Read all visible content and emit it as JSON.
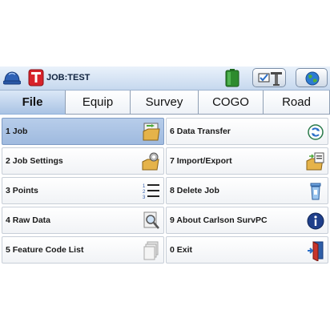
{
  "titlebar": {
    "job_title": "JOB:TEST",
    "icons": [
      "hard-hat-icon",
      "job-file-icon",
      "battery-icon",
      "equipment-icon",
      "globe-icon"
    ]
  },
  "tabs": [
    {
      "label": "File",
      "active": true
    },
    {
      "label": "Equip",
      "active": false
    },
    {
      "label": "Survey",
      "active": false
    },
    {
      "label": "COGO",
      "active": false
    },
    {
      "label": "Road",
      "active": false
    }
  ],
  "menu": {
    "left": [
      {
        "label": "1 Job",
        "icon": "open-folder-icon",
        "selected": true
      },
      {
        "label": "2 Job Settings",
        "icon": "folder-settings-icon",
        "selected": false
      },
      {
        "label": "3 Points",
        "icon": "numbered-list-icon",
        "selected": false
      },
      {
        "label": "4 Raw Data",
        "icon": "magnifier-document-icon",
        "selected": false
      },
      {
        "label": "5 Feature Code List",
        "icon": "stacked-pages-icon",
        "selected": false
      }
    ],
    "right": [
      {
        "label": "6 Data Transfer",
        "icon": "sync-icon",
        "selected": false
      },
      {
        "label": "7 Import/Export",
        "icon": "import-export-icon",
        "selected": false
      },
      {
        "label": "8 Delete Job",
        "icon": "recycle-bin-icon",
        "selected": false
      },
      {
        "label": "9 About Carlson SurvPC",
        "icon": "info-icon",
        "selected": false
      },
      {
        "label": "0 Exit",
        "icon": "exit-door-icon",
        "selected": false
      }
    ]
  },
  "colors": {
    "titlebar": "#c6d8ee",
    "active_tab": "#a9c3e4",
    "selected_item": "#9fbadf",
    "battery": "#2e8b2e",
    "info": "#1f3f8a"
  }
}
